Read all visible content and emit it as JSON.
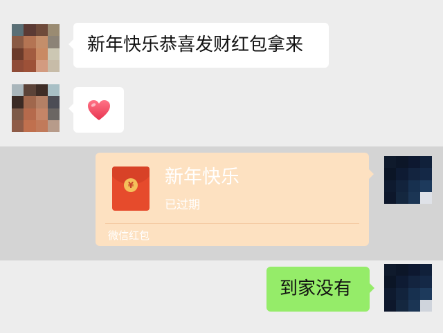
{
  "messages": [
    {
      "side": "left",
      "type": "text",
      "text": "新年快乐恭喜发财红包拿来"
    },
    {
      "side": "left",
      "type": "emoji",
      "emoji": "heart"
    },
    {
      "side": "right",
      "type": "red_packet",
      "title": "新年快乐",
      "status": "已过期",
      "footer": "微信红包",
      "coin_symbol": "¥"
    },
    {
      "side": "right",
      "type": "text",
      "text": "到家没有"
    }
  ],
  "colors": {
    "background": "#ededed",
    "highlight": "#d4d4d4",
    "bubble_incoming": "#ffffff",
    "bubble_outgoing": "#95ec69",
    "red_packet_expired": "#fde1c1",
    "envelope": "#e64b2c",
    "heart": "#ef4b62"
  },
  "icons": {
    "heart": "heart-icon",
    "coin": "yuan-coin-icon",
    "envelope": "red-envelope-icon"
  }
}
